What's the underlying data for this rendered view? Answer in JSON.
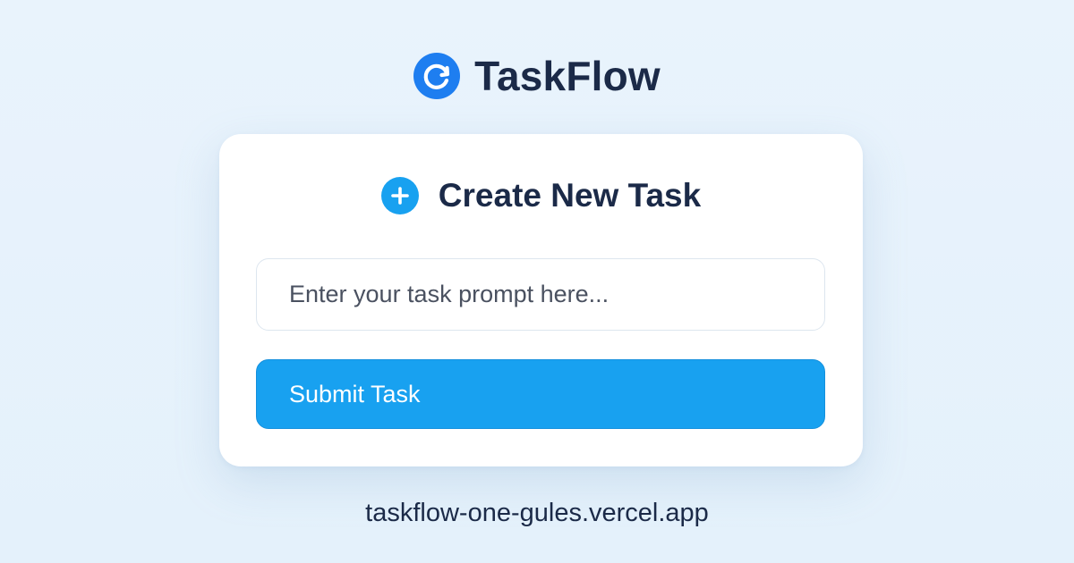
{
  "brand": {
    "name": "TaskFlow",
    "logo_icon": "refresh-arrow-icon",
    "logo_color": "#1e7ef0"
  },
  "card": {
    "title": "Create New Task",
    "title_icon": "plus-circle-icon",
    "title_icon_color": "#18a1f0"
  },
  "form": {
    "task_input": {
      "value": "",
      "placeholder": "Enter your task prompt here..."
    },
    "submit_label": "Submit Task",
    "submit_color": "#18a1f0"
  },
  "footer": {
    "url": "taskflow-one-gules.vercel.app"
  }
}
